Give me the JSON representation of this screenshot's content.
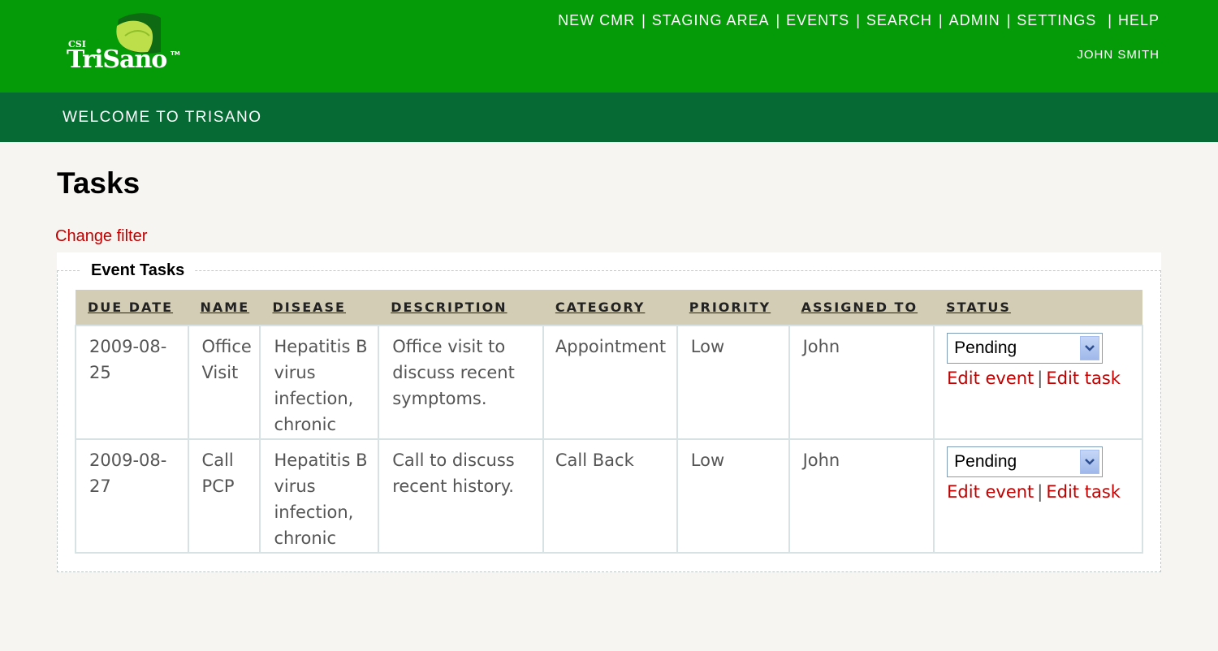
{
  "logo": {
    "prefix": "CSI",
    "name": "TriSano",
    "tm": "TM"
  },
  "nav": {
    "items": [
      "NEW CMR",
      "STAGING AREA",
      "EVENTS",
      "SEARCH",
      "ADMIN",
      "SETTINGS",
      "HELP"
    ],
    "user": "JOHN SMITH"
  },
  "welcome": "WELCOME TO TRISANO",
  "page": {
    "title": "Tasks",
    "change_filter": "Change filter"
  },
  "event_tasks": {
    "legend": "Event Tasks",
    "columns": [
      "DUE DATE",
      "NAME",
      "DISEASE",
      "DESCRIPTION",
      "CATEGORY",
      "PRIORITY",
      "ASSIGNED TO",
      "STATUS"
    ],
    "rows": [
      {
        "due_date": "2009-08-25",
        "name": "Office Visit",
        "disease": "Hepatitis B virus infection, chronic",
        "description": "Office visit to discuss recent symptoms.",
        "category": "Appointment",
        "priority": "Low",
        "assigned_to": "John",
        "status": "Pending",
        "edit_event": "Edit event",
        "edit_task": "Edit task"
      },
      {
        "due_date": "2009-08-27",
        "name": "Call PCP",
        "disease": "Hepatitis B virus infection, chronic",
        "description": "Call to discuss recent history.",
        "category": "Call Back",
        "priority": "Low",
        "assigned_to": "John",
        "status": "Pending",
        "edit_event": "Edit event",
        "edit_task": "Edit task"
      }
    ]
  },
  "colors": {
    "header_green": "#059a07",
    "subheader_green": "#056a33",
    "link_red": "#c20000",
    "table_header": "#d4cdb5"
  }
}
